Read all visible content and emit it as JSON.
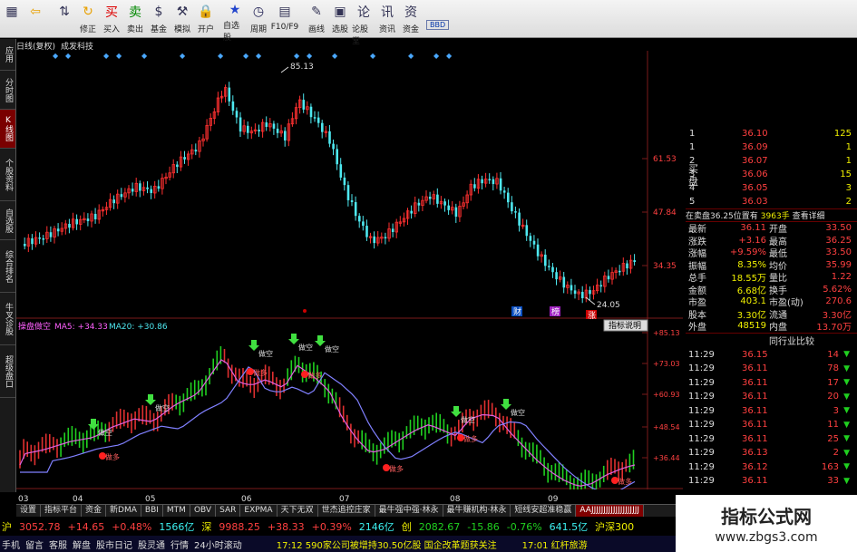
{
  "toolbar": {
    "buttons": [
      {
        "label": "",
        "icon": "grid-icon"
      },
      {
        "label": "",
        "icon": "back-arrow-icon"
      },
      {
        "label": "",
        "icon": "updown-arrows-icon"
      },
      {
        "label": "修正",
        "icon": "refresh-icon"
      },
      {
        "label": "买入",
        "icon": "buy-icon"
      },
      {
        "label": "卖出",
        "icon": "sell-icon"
      },
      {
        "label": "基金",
        "icon": "fund-icon"
      },
      {
        "label": "模拟",
        "icon": "hammer-icon"
      },
      {
        "label": "开户",
        "icon": "lock-icon"
      },
      {
        "label": "自选股",
        "icon": "star-board-icon"
      },
      {
        "label": "周期",
        "icon": "clock-icon"
      },
      {
        "label": "F10/F9",
        "icon": "doc-icon"
      },
      {
        "label": "画线",
        "icon": "pen-icon"
      },
      {
        "label": "选股",
        "icon": "screen-icon"
      },
      {
        "label": "论股堂",
        "icon": "discuss-icon"
      },
      {
        "label": "资讯",
        "icon": "news-icon"
      },
      {
        "label": "资金",
        "icon": "fund-flow-icon"
      }
    ],
    "bbd_label": "BBD"
  },
  "title": {
    "period": "日线(复权)",
    "stock": "成发科技"
  },
  "side_tabs": [
    "应用",
    "分时图",
    "K线图",
    "个股资料",
    "自选股",
    "综合排名",
    "牛叉诊股",
    "超级盘口"
  ],
  "main_chart": {
    "price_labels": [
      "61.53",
      "47.84",
      "34.35"
    ],
    "high_label": "85.13",
    "low_label": "24.05",
    "markers": [
      "财",
      "榜",
      "涨"
    ]
  },
  "sub_chart": {
    "title": "操盘做空",
    "ma5": "MA5: +34.33",
    "ma20": "MA20: +30.86",
    "button": "指标说明",
    "levels": [
      "+85.13",
      "+73.03",
      "+60.93",
      "+48.54",
      "+36.44"
    ],
    "buy_label": "做多",
    "sell_label": "做空"
  },
  "dates": [
    "03",
    "04",
    "05",
    "06",
    "07",
    "08",
    "09"
  ],
  "bottom_tabs": [
    "设置",
    "指标平台",
    "资金",
    "新DMA",
    "BBI",
    "MTM",
    "OBV",
    "SAR",
    "EXPMA",
    "天下无双",
    "世杰追控庄家",
    "最牛强中强·林永",
    "最牛赚机构·林永",
    "短线安超准稳赢"
  ],
  "bottom_tab_selected": "AAJJJJJJJJJJJJJJJJJJJJ",
  "quotes": {
    "buy_side_label": "买盘",
    "buy_rows": [
      {
        "n": "1",
        "price": "36.10",
        "vol": "125"
      },
      {
        "n": "1",
        "price": "36.09",
        "vol": "1"
      },
      {
        "n": "2",
        "price": "36.07",
        "vol": "1"
      },
      {
        "n": "3",
        "price": "36.06",
        "vol": "15"
      },
      {
        "n": "4",
        "price": "36.05",
        "vol": "3"
      },
      {
        "n": "5",
        "price": "36.03",
        "vol": "2"
      }
    ],
    "order_info": "在卖盘36.25位置有",
    "order_vol": "3963手",
    "order_link": "查看详细",
    "stats": [
      {
        "k": "最新",
        "v": "36.11",
        "k2": "开盘",
        "v2": "33.50"
      },
      {
        "k": "涨跌",
        "v": "+3.16",
        "k2": "最高",
        "v2": "36.25"
      },
      {
        "k": "涨幅",
        "v": "+9.59%",
        "k2": "最低",
        "v2": "33.50"
      },
      {
        "k": "振幅",
        "v": "8.35%",
        "k2": "均价",
        "v2": "35.99"
      },
      {
        "k": "总手",
        "v": "18.55万",
        "k2": "量比",
        "v2": "1.22"
      },
      {
        "k": "金额",
        "v": "6.68亿",
        "k2": "换手",
        "v2": "5.62%"
      },
      {
        "k": "市盈",
        "v": "403.1",
        "k2": "市盈(动)",
        "v2": "270.6"
      },
      {
        "k": "股本",
        "v": "3.30亿",
        "k2": "流通",
        "v2": "3.30亿"
      },
      {
        "k": "外盘",
        "v": "48519",
        "k2": "内盘",
        "v2": "13.70万"
      }
    ],
    "industry_label": "同行业比较",
    "ticks": [
      {
        "t": "11:29",
        "p": "36.15",
        "v": "14",
        "d": "down"
      },
      {
        "t": "11:29",
        "p": "36.11",
        "v": "78",
        "d": "down"
      },
      {
        "t": "11:29",
        "p": "36.11",
        "v": "17",
        "d": "down"
      },
      {
        "t": "11:29",
        "p": "36.11",
        "v": "20",
        "d": "down"
      },
      {
        "t": "11:29",
        "p": "36.11",
        "v": "3",
        "d": "down"
      },
      {
        "t": "11:29",
        "p": "36.11",
        "v": "11",
        "d": "down"
      },
      {
        "t": "11:29",
        "p": "36.11",
        "v": "25",
        "d": "down"
      },
      {
        "t": "11:29",
        "p": "36.13",
        "v": "2",
        "d": "down"
      },
      {
        "t": "11:29",
        "p": "36.12",
        "v": "163",
        "d": "down"
      },
      {
        "t": "11:29",
        "p": "36.11",
        "v": "33",
        "d": "down"
      }
    ]
  },
  "status1": {
    "sh": "沪",
    "sh_idx": "3052.78",
    "sh_chg": "+14.65",
    "sh_pct": "+0.48%",
    "sh_amt": "1566亿",
    "sz": "深",
    "sz_idx": "9988.25",
    "sz_chg": "+38.33",
    "sz_pct": "+0.39%",
    "sz_amt": "2146亿",
    "cy": "创",
    "cy_idx": "2082.67",
    "cy_chg": "-15.86",
    "cy_pct": "-0.76%",
    "cy_amt": "641.5亿",
    "hs": "沪深300"
  },
  "status2": {
    "items": [
      "手机",
      "留言",
      "客服",
      "解盘",
      "股市日记",
      "股灵通",
      "行情",
      "24小时滚动"
    ],
    "news1": "17:12 590家公司被增持30.50亿股 国企改革题获关注",
    "news2": "17:01 红杆旅游"
  },
  "brand": {
    "title": "指标公式网",
    "url": "www.zbgs3.com"
  }
}
